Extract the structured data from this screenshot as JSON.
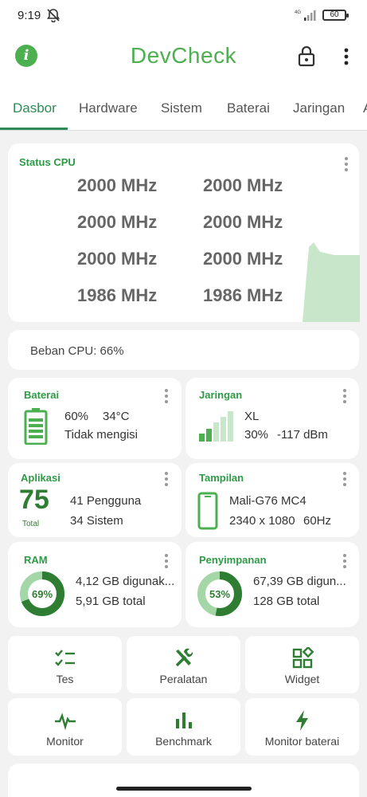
{
  "status_bar": {
    "time": "9:19",
    "battery": "60",
    "network": "4G"
  },
  "app": {
    "title": "DevCheck"
  },
  "tabs": [
    "Dasbor",
    "Hardware",
    "Sistem",
    "Baterai",
    "Jaringan",
    "A"
  ],
  "cpu_status": {
    "title": "Status CPU",
    "frequencies": [
      "2000 MHz",
      "2000 MHz",
      "2000 MHz",
      "2000 MHz",
      "2000 MHz",
      "2000 MHz",
      "1986 MHz",
      "1986 MHz"
    ]
  },
  "cpu_load": {
    "text": "Beban CPU: 66%"
  },
  "battery_card": {
    "title": "Baterai",
    "level": "60%",
    "temp": "34°C",
    "state": "Tidak mengisi"
  },
  "network_card": {
    "title": "Jaringan",
    "type": "XL",
    "strength": "30%",
    "dbm": "-117 dBm"
  },
  "apps_card": {
    "title": "Aplikasi",
    "total": "75",
    "total_label": "Total",
    "users": "41 Pengguna",
    "system": "34 Sistem"
  },
  "display_card": {
    "title": "Tampilan",
    "gpu": "Mali-G76 MC4",
    "resolution": "2340 x 1080",
    "refresh": "60Hz"
  },
  "ram_card": {
    "title": "RAM",
    "percent": "69%",
    "percent_value": 69,
    "used": "4,12 GB digunak...",
    "total": "5,91 GB total"
  },
  "storage_card": {
    "title": "Penyimpanan",
    "percent": "53%",
    "percent_value": 53,
    "used": "67,39 GB digun...",
    "total": "128 GB total"
  },
  "tools": [
    {
      "label": "Tes",
      "icon": "checklist-icon"
    },
    {
      "label": "Peralatan",
      "icon": "tools-icon"
    },
    {
      "label": "Widget",
      "icon": "widget-icon"
    },
    {
      "label": "Monitor",
      "icon": "pulse-icon"
    },
    {
      "label": "Benchmark",
      "icon": "bar-chart-icon"
    },
    {
      "label": "Monitor baterai",
      "icon": "bolt-icon"
    }
  ],
  "colors": {
    "accent": "#4caf50",
    "dark_green": "#2e7d32",
    "light_green": "#a5d6a7",
    "background": "#f2f2f2"
  }
}
